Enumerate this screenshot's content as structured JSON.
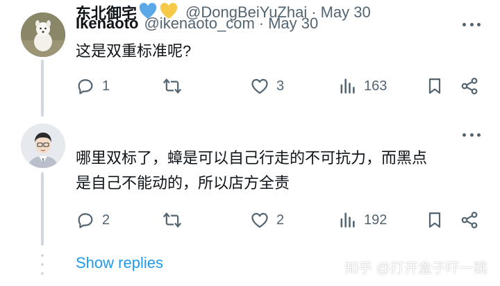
{
  "tweets": [
    {
      "display_name": "Ikenaoto",
      "handle": "@ikenaoto_com",
      "separator": "·",
      "date": "May 30",
      "text": "这是双重标准呢?",
      "reply_count": "1",
      "retweet_count": "",
      "like_count": "3",
      "view_count": "163"
    },
    {
      "display_name": "东北御宅",
      "name_emoji": "💙💛",
      "handle": "@DongBeiYuZhai",
      "separator": "·",
      "date": "May 30",
      "text_line1": "哪里双标了，蟑是可以自己行走的不可抗力，而黑点",
      "text_line2": "是自己不能动的，所以店方全责",
      "reply_count": "2",
      "retweet_count": "",
      "like_count": "2",
      "view_count": "192"
    }
  ],
  "show_replies_label": "Show replies",
  "watermark": "知乎 @打开盒子吓一跳",
  "colors": {
    "text_primary": "#0f1419",
    "text_secondary": "#536471",
    "link": "#1d9bf0",
    "thread_line": "#cfd9de"
  }
}
